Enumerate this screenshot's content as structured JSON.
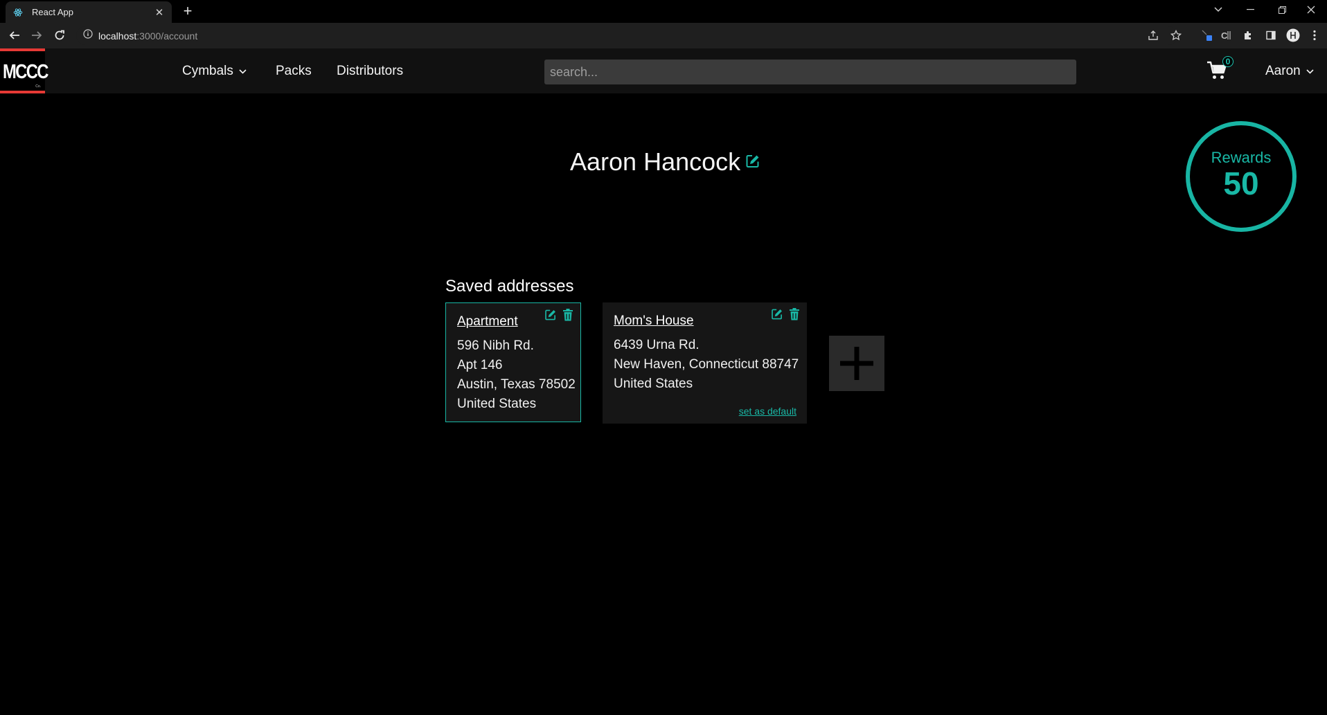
{
  "browser": {
    "tab_title": "React App",
    "url_host": "localhost",
    "url_path": ":3000/account"
  },
  "navbar": {
    "logo_text": "MCCC",
    "logo_sub": "Co.",
    "links": [
      {
        "label": "Cymbals",
        "has_dropdown": true
      },
      {
        "label": "Packs",
        "has_dropdown": false
      },
      {
        "label": "Distributors",
        "has_dropdown": false
      }
    ],
    "search_placeholder": "search...",
    "cart_count": "0",
    "user_label": "Aaron"
  },
  "profile": {
    "name": "Aaron Hancock",
    "rewards_label": "Rewards",
    "rewards_points": "50"
  },
  "addresses": {
    "title": "Saved addresses",
    "items": [
      {
        "name": "Apartment",
        "lines": [
          "596 Nibh Rd.",
          "Apt 146",
          "Austin, Texas 78502",
          "United States"
        ],
        "is_default": true
      },
      {
        "name": "Mom's House",
        "lines": [
          "6439 Urna Rd.",
          "New Haven, Connecticut 88747",
          "United States"
        ],
        "is_default": false,
        "set_default_label": "set as default"
      }
    ]
  },
  "colors": {
    "accent": "#19b8a6",
    "logo_red": "#e53935",
    "navbar_bg": "#111111",
    "page_bg": "#000000"
  }
}
